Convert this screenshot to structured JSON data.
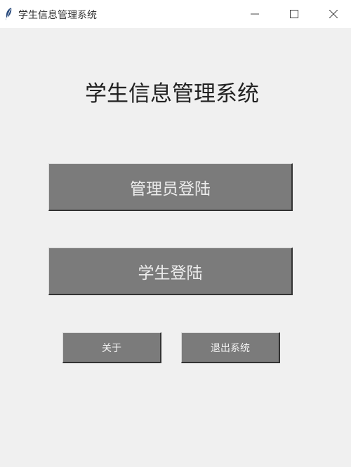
{
  "window": {
    "title": "学生信息管理系统",
    "icon": "feather-icon",
    "controls": [
      "minimize-icon",
      "maximize-icon",
      "close-icon"
    ]
  },
  "main": {
    "heading": "学生信息管理系统",
    "admin_login_label": "管理员登陆",
    "student_login_label": "学生登陆",
    "about_label": "关于",
    "exit_label": "退出系统"
  },
  "colors": {
    "window_bg": "#f0f0f0",
    "titlebar_bg": "#ffffff",
    "button_bg": "#7b7b7b",
    "button_text": "#ececec"
  }
}
